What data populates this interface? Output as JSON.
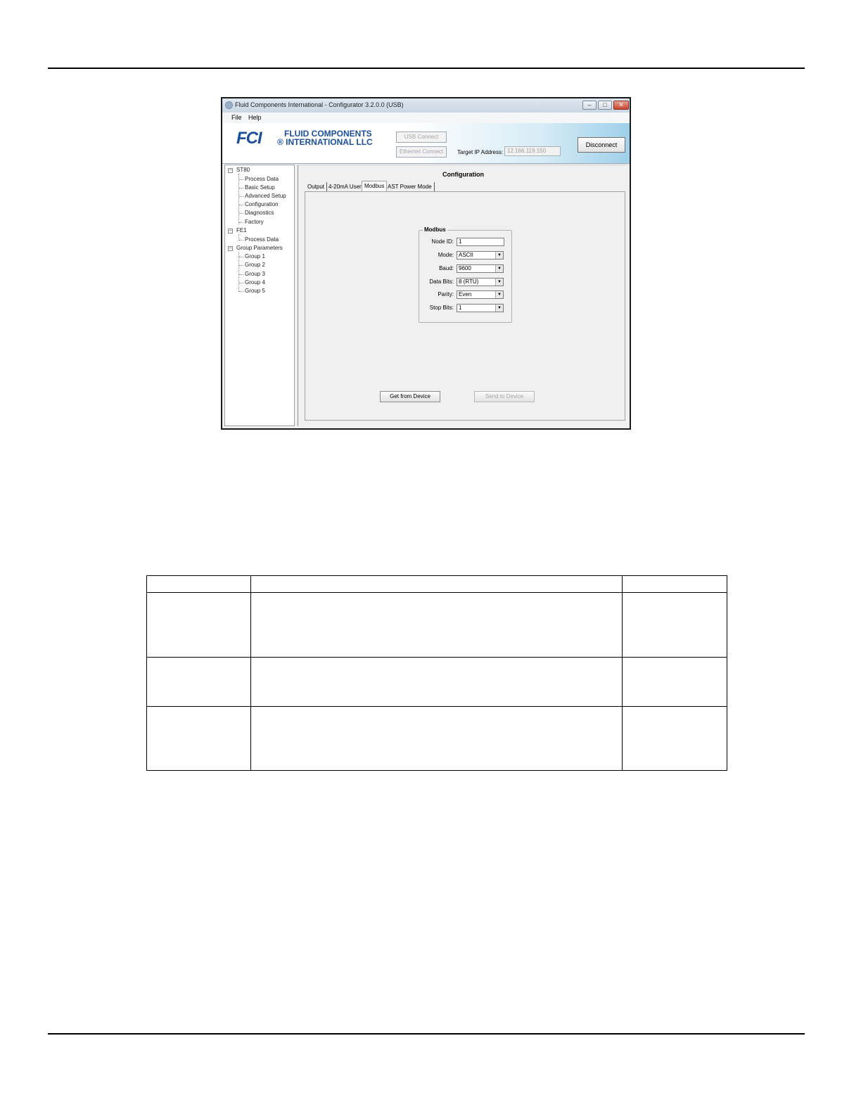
{
  "window": {
    "title": "Fluid Components International - Configurator 3.2.0.0 (USB)",
    "controls": {
      "minimize": "–",
      "maximize": "□",
      "close": "✕"
    }
  },
  "menu": {
    "file": "File",
    "help": "Help"
  },
  "header": {
    "logo_mark": "FCI",
    "logo_line1": "FLUID COMPONENTS",
    "logo_line2": "® INTERNATIONAL LLC",
    "usb_connect": "USB Connect",
    "ethernet_connect": "Ethernet Connect",
    "target_ip_label": "Target IP Address:",
    "target_ip_value": "12.166.119.150",
    "disconnect": "Disconnect"
  },
  "tree": {
    "st80": "ST80",
    "st80_items": [
      "Process Data",
      "Basic Setup",
      "Advanced Setup",
      "Configuration",
      "Diagnostics",
      "Factory"
    ],
    "fe1": "FE1",
    "fe1_items": [
      "Process Data"
    ],
    "group_params": "Group Parameters",
    "group_items": [
      "Group 1",
      "Group 2",
      "Group 3",
      "Group 4",
      "Group 5"
    ]
  },
  "content": {
    "title": "Configuration",
    "tabs": [
      "Output",
      "4-20mA User",
      "Modbus",
      "AST Power Mode"
    ],
    "active_tab": "Modbus",
    "group_title": "Modbus",
    "fields": {
      "node_id_label": "Node ID:",
      "node_id_value": "1",
      "mode_label": "Mode:",
      "mode_value": "ASCII",
      "baud_label": "Baud:",
      "baud_value": "9600",
      "data_bits_label": "Data Bits:",
      "data_bits_value": "8 (RTU)",
      "parity_label": "Parity:",
      "parity_value": "Even",
      "stop_bits_label": "Stop Bits:",
      "stop_bits_value": "1"
    },
    "get_from_device": "Get from Device",
    "send_to_device": "Send to Device"
  },
  "icons": {
    "dropdown": "chevron-down-icon",
    "expand": "minus-box-icon"
  }
}
